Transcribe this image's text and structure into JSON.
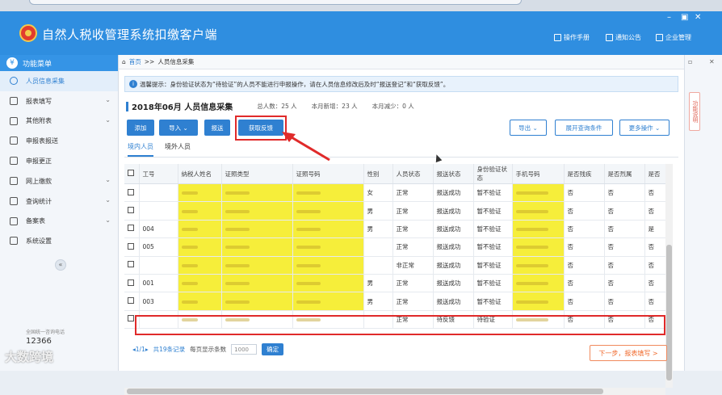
{
  "app": {
    "title": "自然人税收管理系统扣缴客户端",
    "window_controls": [
      "–",
      "▣",
      "✕"
    ]
  },
  "top_links": [
    "操作手册",
    "通知公告",
    "企业管理"
  ],
  "sidebar": {
    "header": "功能菜单",
    "items": [
      {
        "label": "人员信息采集",
        "icon": "person-icon",
        "active": true,
        "has_arrow": false
      },
      {
        "label": "报表填写",
        "icon": "edit-icon",
        "active": false,
        "has_arrow": true
      },
      {
        "label": "其他附表",
        "icon": "grid-icon",
        "active": false,
        "has_arrow": true
      },
      {
        "label": "申报表报送",
        "icon": "document-icon",
        "active": false,
        "has_arrow": false
      },
      {
        "label": "申报更正",
        "icon": "search-icon",
        "active": false,
        "has_arrow": false
      },
      {
        "label": "网上缴款",
        "icon": "wallet-icon",
        "active": false,
        "has_arrow": true
      },
      {
        "label": "查询统计",
        "icon": "query-icon",
        "active": false,
        "has_arrow": true
      },
      {
        "label": "备案表",
        "icon": "file-icon",
        "active": false,
        "has_arrow": true
      },
      {
        "label": "系统设置",
        "icon": "gear-icon",
        "active": false,
        "has_arrow": false
      }
    ],
    "hotline_label": "全国统一咨询电话",
    "hotline_number": "12366"
  },
  "watermark": "大数跨境",
  "breadcrumb": {
    "home": "首页",
    "sep": ">>",
    "current": "人员信息采集"
  },
  "notice": "温馨提示：身份验证状态为“待验证”的人员不能进行申报操作，请在人员信息修改后及时“报送登记”和“获取反馈”。",
  "header": {
    "period": "2018年06月",
    "title": "人员信息采集",
    "total": "总人数：25 人",
    "added": "本月新增：23 人",
    "reduced": "本月减少：0 人"
  },
  "buttons": {
    "add": "添加",
    "import": "导入 ⌄",
    "submit": "报送",
    "get_feedback": "获取反馈",
    "export": "导出 ⌄",
    "expand_query": "展开查询条件",
    "more": "更多操作 ⌄"
  },
  "tabs": [
    "境内人员",
    "境外人员"
  ],
  "table": {
    "columns": [
      "",
      "工号",
      "纳税人姓名",
      "证照类型",
      "证照号码",
      "性别",
      "人员状态",
      "报送状态",
      "身份验证状态",
      "手机号码",
      "是否残疾",
      "是否烈属",
      "是否"
    ],
    "rows": [
      [
        "",
        "",
        "",
        "",
        "",
        "女",
        "正常",
        "报送成功",
        "暂不验证",
        "",
        "否",
        "否",
        "否"
      ],
      [
        "",
        "",
        "",
        "",
        "",
        "男",
        "正常",
        "报送成功",
        "暂不验证",
        "",
        "否",
        "否",
        "否"
      ],
      [
        "",
        "004",
        "",
        "",
        "",
        "男",
        "正常",
        "报送成功",
        "暂不验证",
        "",
        "否",
        "否",
        "是"
      ],
      [
        "",
        "005",
        "",
        "",
        "",
        "",
        "正常",
        "报送成功",
        "暂不验证",
        "",
        "否",
        "否",
        "否"
      ],
      [
        "",
        "",
        "",
        "",
        "",
        "",
        "非正常",
        "报送成功",
        "暂不验证",
        "",
        "否",
        "否",
        "否"
      ],
      [
        "",
        "001",
        "",
        "",
        "",
        "男",
        "正常",
        "报送成功",
        "暂不验证",
        "",
        "否",
        "否",
        "否"
      ],
      [
        "",
        "003",
        "",
        "",
        "",
        "男",
        "正常",
        "报送成功",
        "暂不验证",
        "",
        "否",
        "否",
        "否"
      ],
      [
        "",
        "",
        "",
        "",
        "",
        "",
        "正常",
        "待反馈",
        "待验证",
        "",
        "否",
        "否",
        "否"
      ]
    ]
  },
  "pager": {
    "page": "1/1",
    "total": "共19条记录",
    "per_page_label": "每页显示条数",
    "per_page_value": "1000",
    "confirm": "确定"
  },
  "next_step": "下一步，报表填写 >",
  "right_rail": {
    "tab_label": "功能说明"
  },
  "colors": {
    "accent": "#2f80d1",
    "highlight": "#e02a2a",
    "mask": "#f6ee3a"
  }
}
